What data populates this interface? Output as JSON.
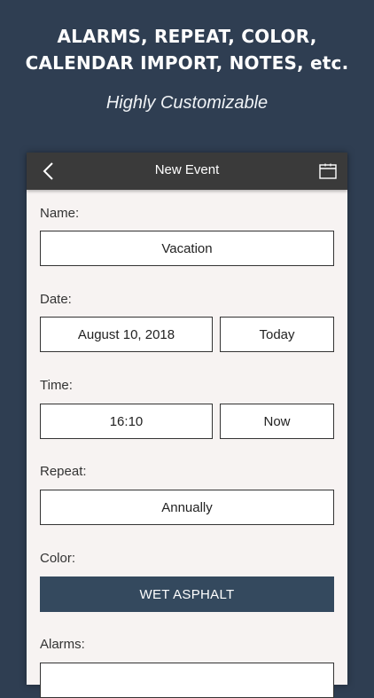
{
  "promo": {
    "title_line1": "ALARMS, REPEAT, COLOR,",
    "title_line2": "CALENDAR IMPORT, NOTES, etc.",
    "subtitle": "Highly Customizable"
  },
  "navbar": {
    "title": "New Event",
    "back_icon": "chevron-left-icon",
    "calendar_icon": "calendar-icon"
  },
  "form": {
    "name": {
      "label": "Name:",
      "value": "Vacation"
    },
    "date": {
      "label": "Date:",
      "value": "August 10, 2018",
      "today_label": "Today"
    },
    "time": {
      "label": "Time:",
      "value": "16:10",
      "now_label": "Now"
    },
    "repeat": {
      "label": "Repeat:",
      "value": "Annually"
    },
    "color": {
      "label": "Color:",
      "value": "WET ASPHALT",
      "hex": "#34495e"
    },
    "alarms": {
      "label": "Alarms:"
    }
  },
  "colors": {
    "background": "#2f3e52",
    "navbar": "#3a3a3a",
    "screen": "#f7f3f2"
  }
}
